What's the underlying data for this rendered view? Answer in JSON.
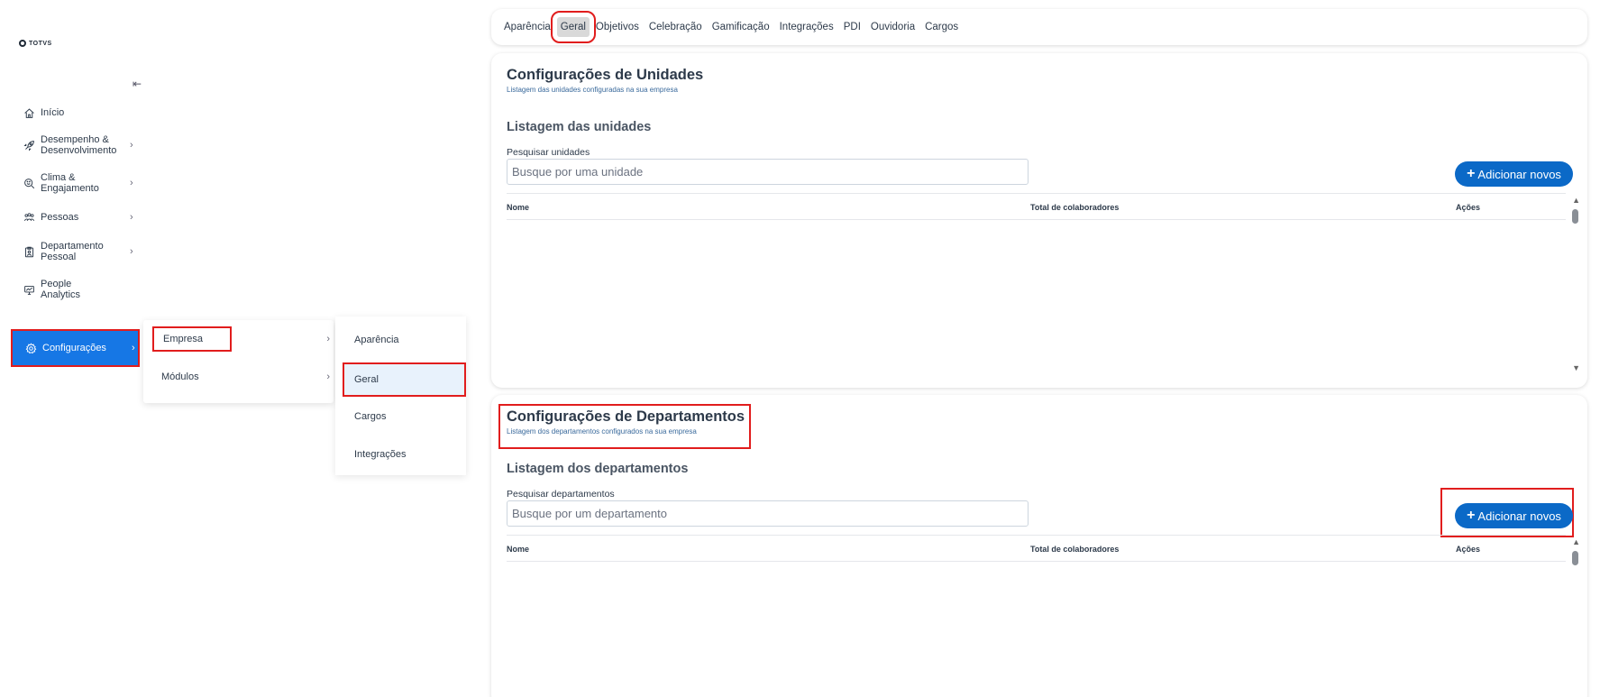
{
  "brand": {
    "logo_text": "TOTVS"
  },
  "sidebar": {
    "collapse_icon": "collapse-left-icon",
    "items": [
      {
        "label": "Início",
        "icon": "home-icon",
        "has_chevron": false
      },
      {
        "label": "Desempenho &\nDesenvolvimento",
        "icon": "rocket-icon",
        "has_chevron": true
      },
      {
        "label": "Clima &\nEngajamento",
        "icon": "search-emotion-icon",
        "has_chevron": true
      },
      {
        "label": "Pessoas",
        "icon": "people-icon",
        "has_chevron": true
      },
      {
        "label": "Departamento\nPessoal",
        "icon": "badge-icon",
        "has_chevron": true
      },
      {
        "label": "People\nAnalytics",
        "icon": "analytics-icon",
        "has_chevron": false
      },
      {
        "label": "Configurações",
        "icon": "gear-icon",
        "has_chevron": true,
        "active": true
      }
    ]
  },
  "flyout_level1": [
    {
      "label": "Empresa",
      "highlighted": true
    },
    {
      "label": "Módulos"
    }
  ],
  "flyout_level2": [
    {
      "label": "Aparência"
    },
    {
      "label": "Geral",
      "selected": true
    },
    {
      "label": "Cargos"
    },
    {
      "label": "Integrações"
    }
  ],
  "tabs": [
    {
      "label": "Aparência"
    },
    {
      "label": "Geral",
      "active": true
    },
    {
      "label": "Objetivos"
    },
    {
      "label": "Celebração"
    },
    {
      "label": "Gamificação"
    },
    {
      "label": "Integrações"
    },
    {
      "label": "PDI"
    },
    {
      "label": "Ouvidoria"
    },
    {
      "label": "Cargos"
    }
  ],
  "units": {
    "title": "Configurações de Unidades",
    "subtitle": "Listagem das unidades configuradas na sua empresa",
    "section_title": "Listagem das unidades",
    "search_label": "Pesquisar unidades",
    "search_placeholder": "Busque por uma unidade",
    "add_button": "Adicionar novos",
    "columns": [
      "Nome",
      "Total de colaboradores",
      "Ações"
    ],
    "rows": []
  },
  "departments": {
    "title": "Configurações de Departamentos",
    "subtitle": "Listagem dos departamentos configurados na sua empresa",
    "section_title": "Listagem dos departamentos",
    "search_label": "Pesquisar departamentos",
    "search_placeholder": "Busque por um departamento",
    "add_button": "Adicionar novos",
    "columns": [
      "Nome",
      "Total de colaboradores",
      "Ações"
    ],
    "rows": []
  },
  "colors": {
    "accent": "#1677e5",
    "button": "#0b69c7",
    "highlight": "#e11d1d",
    "selected_bg": "#e8f2fc"
  }
}
